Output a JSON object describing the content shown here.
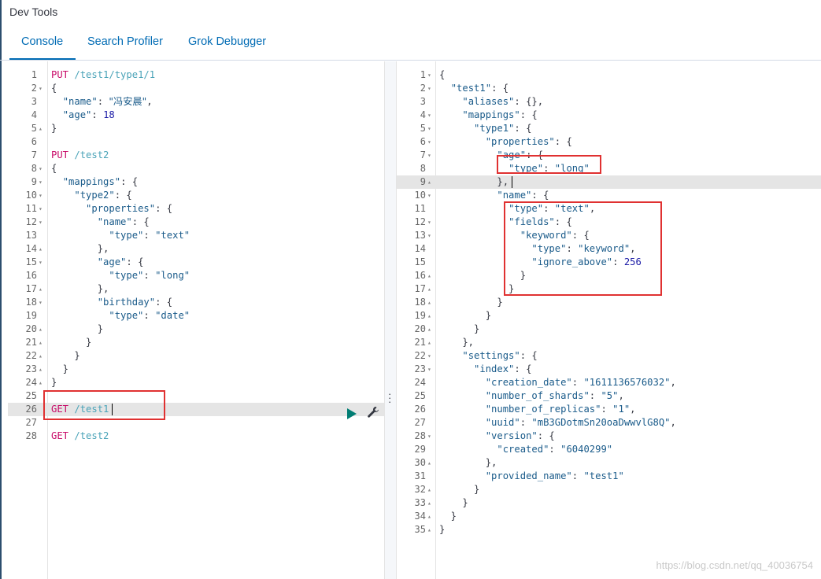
{
  "app": {
    "title": "Dev Tools"
  },
  "tabs": [
    {
      "label": "Console",
      "active": true
    },
    {
      "label": "Search Profiler",
      "active": false
    },
    {
      "label": "Grok Debugger",
      "active": false
    }
  ],
  "request": {
    "highlighted_line": 26,
    "lines": [
      [
        {
          "t": "PUT",
          "c": "method"
        },
        {
          "t": " /test1/type1/1",
          "c": "url"
        }
      ],
      [
        {
          "t": "{",
          "c": "punc"
        }
      ],
      [
        {
          "t": "  ",
          "c": "punc"
        },
        {
          "t": "\"name\"",
          "c": "key"
        },
        {
          "t": ": ",
          "c": "punc"
        },
        {
          "t": "\"冯安晨\"",
          "c": "str"
        },
        {
          "t": ",",
          "c": "punc"
        }
      ],
      [
        {
          "t": "  ",
          "c": "punc"
        },
        {
          "t": "\"age\"",
          "c": "key"
        },
        {
          "t": ": ",
          "c": "punc"
        },
        {
          "t": "18",
          "c": "num"
        }
      ],
      [
        {
          "t": "}",
          "c": "punc"
        }
      ],
      [],
      [
        {
          "t": "PUT",
          "c": "method"
        },
        {
          "t": " /test2",
          "c": "url"
        }
      ],
      [
        {
          "t": "{",
          "c": "punc"
        }
      ],
      [
        {
          "t": "  ",
          "c": "punc"
        },
        {
          "t": "\"mappings\"",
          "c": "key"
        },
        {
          "t": ": {",
          "c": "punc"
        }
      ],
      [
        {
          "t": "    ",
          "c": "punc"
        },
        {
          "t": "\"type2\"",
          "c": "key"
        },
        {
          "t": ": {",
          "c": "punc"
        }
      ],
      [
        {
          "t": "      ",
          "c": "punc"
        },
        {
          "t": "\"properties\"",
          "c": "key"
        },
        {
          "t": ": {",
          "c": "punc"
        }
      ],
      [
        {
          "t": "        ",
          "c": "punc"
        },
        {
          "t": "\"name\"",
          "c": "key"
        },
        {
          "t": ": {",
          "c": "punc"
        }
      ],
      [
        {
          "t": "          ",
          "c": "punc"
        },
        {
          "t": "\"type\"",
          "c": "key"
        },
        {
          "t": ": ",
          "c": "punc"
        },
        {
          "t": "\"text\"",
          "c": "str"
        }
      ],
      [
        {
          "t": "        },",
          "c": "punc"
        }
      ],
      [
        {
          "t": "        ",
          "c": "punc"
        },
        {
          "t": "\"age\"",
          "c": "key"
        },
        {
          "t": ": {",
          "c": "punc"
        }
      ],
      [
        {
          "t": "          ",
          "c": "punc"
        },
        {
          "t": "\"type\"",
          "c": "key"
        },
        {
          "t": ": ",
          "c": "punc"
        },
        {
          "t": "\"long\"",
          "c": "str"
        }
      ],
      [
        {
          "t": "        },",
          "c": "punc"
        }
      ],
      [
        {
          "t": "        ",
          "c": "punc"
        },
        {
          "t": "\"birthday\"",
          "c": "key"
        },
        {
          "t": ": {",
          "c": "punc"
        }
      ],
      [
        {
          "t": "          ",
          "c": "punc"
        },
        {
          "t": "\"type\"",
          "c": "key"
        },
        {
          "t": ": ",
          "c": "punc"
        },
        {
          "t": "\"date\"",
          "c": "str"
        }
      ],
      [
        {
          "t": "        }",
          "c": "punc"
        }
      ],
      [
        {
          "t": "      }",
          "c": "punc"
        }
      ],
      [
        {
          "t": "    }",
          "c": "punc"
        }
      ],
      [
        {
          "t": "  }",
          "c": "punc"
        }
      ],
      [
        {
          "t": "}",
          "c": "punc"
        }
      ],
      [],
      [
        {
          "t": "GET",
          "c": "method"
        },
        {
          "t": " /test1",
          "c": "url"
        }
      ],
      [],
      [
        {
          "t": "GET",
          "c": "method"
        },
        {
          "t": " /test2",
          "c": "url"
        }
      ]
    ],
    "folds": {
      "2": "▾",
      "5": "▴",
      "8": "▾",
      "9": "▾",
      "10": "▾",
      "11": "▾",
      "12": "▾",
      "14": "▴",
      "15": "▾",
      "17": "▴",
      "18": "▾",
      "20": "▴",
      "21": "▴",
      "22": "▴",
      "23": "▴",
      "24": "▴"
    }
  },
  "response": {
    "highlighted_line": 9,
    "lines": [
      [
        {
          "t": "{",
          "c": "punc"
        }
      ],
      [
        {
          "t": "  ",
          "c": "punc"
        },
        {
          "t": "\"test1\"",
          "c": "key"
        },
        {
          "t": ": {",
          "c": "punc"
        }
      ],
      [
        {
          "t": "    ",
          "c": "punc"
        },
        {
          "t": "\"aliases\"",
          "c": "key"
        },
        {
          "t": ": {},",
          "c": "punc"
        }
      ],
      [
        {
          "t": "    ",
          "c": "punc"
        },
        {
          "t": "\"mappings\"",
          "c": "key"
        },
        {
          "t": ": {",
          "c": "punc"
        }
      ],
      [
        {
          "t": "      ",
          "c": "punc"
        },
        {
          "t": "\"type1\"",
          "c": "key"
        },
        {
          "t": ": {",
          "c": "punc"
        }
      ],
      [
        {
          "t": "        ",
          "c": "punc"
        },
        {
          "t": "\"properties\"",
          "c": "key"
        },
        {
          "t": ": {",
          "c": "punc"
        }
      ],
      [
        {
          "t": "          ",
          "c": "punc"
        },
        {
          "t": "\"age\"",
          "c": "key"
        },
        {
          "t": ": {",
          "c": "punc"
        }
      ],
      [
        {
          "t": "            ",
          "c": "punc"
        },
        {
          "t": "\"type\"",
          "c": "key"
        },
        {
          "t": ": ",
          "c": "punc"
        },
        {
          "t": "\"long\"",
          "c": "str"
        }
      ],
      [
        {
          "t": "          },",
          "c": "punc"
        }
      ],
      [
        {
          "t": "          ",
          "c": "punc"
        },
        {
          "t": "\"name\"",
          "c": "key"
        },
        {
          "t": ": {",
          "c": "punc"
        }
      ],
      [
        {
          "t": "            ",
          "c": "punc"
        },
        {
          "t": "\"type\"",
          "c": "key"
        },
        {
          "t": ": ",
          "c": "punc"
        },
        {
          "t": "\"text\"",
          "c": "str"
        },
        {
          "t": ",",
          "c": "punc"
        }
      ],
      [
        {
          "t": "            ",
          "c": "punc"
        },
        {
          "t": "\"fields\"",
          "c": "key"
        },
        {
          "t": ": {",
          "c": "punc"
        }
      ],
      [
        {
          "t": "              ",
          "c": "punc"
        },
        {
          "t": "\"keyword\"",
          "c": "key"
        },
        {
          "t": ": {",
          "c": "punc"
        }
      ],
      [
        {
          "t": "                ",
          "c": "punc"
        },
        {
          "t": "\"type\"",
          "c": "key"
        },
        {
          "t": ": ",
          "c": "punc"
        },
        {
          "t": "\"keyword\"",
          "c": "str"
        },
        {
          "t": ",",
          "c": "punc"
        }
      ],
      [
        {
          "t": "                ",
          "c": "punc"
        },
        {
          "t": "\"ignore_above\"",
          "c": "key"
        },
        {
          "t": ": ",
          "c": "punc"
        },
        {
          "t": "256",
          "c": "num"
        }
      ],
      [
        {
          "t": "              }",
          "c": "punc"
        }
      ],
      [
        {
          "t": "            }",
          "c": "punc"
        }
      ],
      [
        {
          "t": "          }",
          "c": "punc"
        }
      ],
      [
        {
          "t": "        }",
          "c": "punc"
        }
      ],
      [
        {
          "t": "      }",
          "c": "punc"
        }
      ],
      [
        {
          "t": "    },",
          "c": "punc"
        }
      ],
      [
        {
          "t": "    ",
          "c": "punc"
        },
        {
          "t": "\"settings\"",
          "c": "key"
        },
        {
          "t": ": {",
          "c": "punc"
        }
      ],
      [
        {
          "t": "      ",
          "c": "punc"
        },
        {
          "t": "\"index\"",
          "c": "key"
        },
        {
          "t": ": {",
          "c": "punc"
        }
      ],
      [
        {
          "t": "        ",
          "c": "punc"
        },
        {
          "t": "\"creation_date\"",
          "c": "key"
        },
        {
          "t": ": ",
          "c": "punc"
        },
        {
          "t": "\"1611136576032\"",
          "c": "str"
        },
        {
          "t": ",",
          "c": "punc"
        }
      ],
      [
        {
          "t": "        ",
          "c": "punc"
        },
        {
          "t": "\"number_of_shards\"",
          "c": "key"
        },
        {
          "t": ": ",
          "c": "punc"
        },
        {
          "t": "\"5\"",
          "c": "str"
        },
        {
          "t": ",",
          "c": "punc"
        }
      ],
      [
        {
          "t": "        ",
          "c": "punc"
        },
        {
          "t": "\"number_of_replicas\"",
          "c": "key"
        },
        {
          "t": ": ",
          "c": "punc"
        },
        {
          "t": "\"1\"",
          "c": "str"
        },
        {
          "t": ",",
          "c": "punc"
        }
      ],
      [
        {
          "t": "        ",
          "c": "punc"
        },
        {
          "t": "\"uuid\"",
          "c": "key"
        },
        {
          "t": ": ",
          "c": "punc"
        },
        {
          "t": "\"mB3GDotmSn20oaDwwvlG8Q\"",
          "c": "str"
        },
        {
          "t": ",",
          "c": "punc"
        }
      ],
      [
        {
          "t": "        ",
          "c": "punc"
        },
        {
          "t": "\"version\"",
          "c": "key"
        },
        {
          "t": ": {",
          "c": "punc"
        }
      ],
      [
        {
          "t": "          ",
          "c": "punc"
        },
        {
          "t": "\"created\"",
          "c": "key"
        },
        {
          "t": ": ",
          "c": "punc"
        },
        {
          "t": "\"6040299\"",
          "c": "str"
        }
      ],
      [
        {
          "t": "        },",
          "c": "punc"
        }
      ],
      [
        {
          "t": "        ",
          "c": "punc"
        },
        {
          "t": "\"provided_name\"",
          "c": "key"
        },
        {
          "t": ": ",
          "c": "punc"
        },
        {
          "t": "\"test1\"",
          "c": "str"
        }
      ],
      [
        {
          "t": "      }",
          "c": "punc"
        }
      ],
      [
        {
          "t": "    }",
          "c": "punc"
        }
      ],
      [
        {
          "t": "  }",
          "c": "punc"
        }
      ],
      [
        {
          "t": "}",
          "c": "punc"
        }
      ]
    ],
    "folds": {
      "1": "▾",
      "2": "▾",
      "4": "▾",
      "5": "▾",
      "6": "▾",
      "7": "▾",
      "9": "▴",
      "10": "▾",
      "12": "▾",
      "13": "▾",
      "16": "▴",
      "17": "▴",
      "18": "▴",
      "19": "▴",
      "20": "▴",
      "21": "▴",
      "22": "▾",
      "23": "▾",
      "28": "▾",
      "30": "▴",
      "32": "▴",
      "33": "▴",
      "34": "▴",
      "35": "▴"
    }
  },
  "watermark": "https://blog.csdn.net/qq_40036754",
  "icons": {
    "run": "play-icon",
    "settings": "wrench-icon",
    "divider": "vertical-dots-icon"
  },
  "colors": {
    "method": "#c80a68",
    "url": "#4aa3b8",
    "key": "#1a5b8a",
    "number": "#1a1aa6",
    "accent": "#006bb4",
    "annotation_box": "#e03131"
  }
}
